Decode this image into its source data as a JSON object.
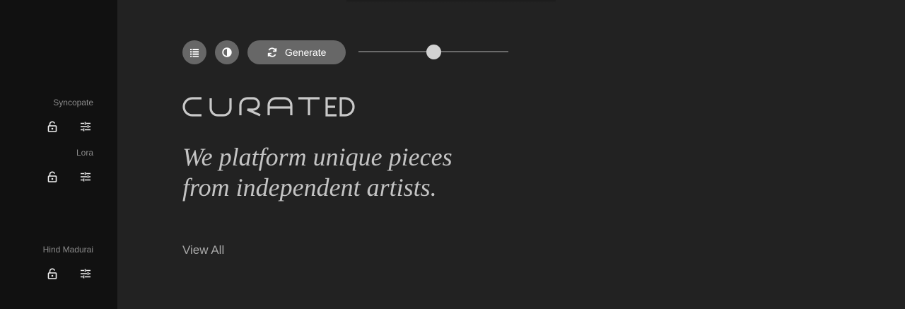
{
  "sidebar": {
    "fonts": [
      {
        "name": "Syncopate",
        "lock_icon": "unlocked-lock-icon",
        "settings_icon": "sliders-icon"
      },
      {
        "name": "Lora",
        "lock_icon": "unlocked-lock-icon",
        "settings_icon": "sliders-icon"
      },
      {
        "name": "Hind Madurai",
        "lock_icon": "unlocked-lock-icon",
        "settings_icon": "sliders-icon"
      }
    ]
  },
  "toolbar": {
    "list_icon": "list-icon",
    "contrast_icon": "contrast-icon",
    "generate_icon": "refresh-icon",
    "generate_label": "Generate",
    "slider_value": 0.5
  },
  "main": {
    "logo_text": "CURATED",
    "tagline_line1": "We platform unique pieces",
    "tagline_line2": "from independent artists.",
    "view_all": "View All"
  },
  "colors": {
    "background": "#222222",
    "sidebar": "#111111",
    "button": "#676767",
    "text": "#c3c3c3"
  }
}
